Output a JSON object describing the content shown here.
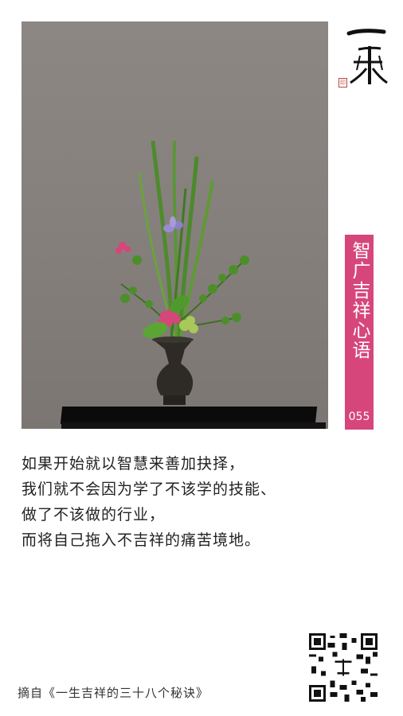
{
  "logo": {
    "text": "一乘",
    "seal": "印"
  },
  "tag": {
    "title": "智广吉祥心语",
    "number": "055"
  },
  "quote": {
    "lines": [
      "如果开始就以智慧来善加抉择，",
      "我们就不会因为学了不该学的技能、",
      "做了不该做的行业，",
      "而将自己拖入不吉祥的痛苦境地。"
    ]
  },
  "source": "摘自《一生吉祥的三十八个秘诀》",
  "colors": {
    "accent": "#d6467a",
    "text": "#222222"
  },
  "icons": {
    "qr": "qr-code-icon",
    "vase": "vase-icon"
  }
}
